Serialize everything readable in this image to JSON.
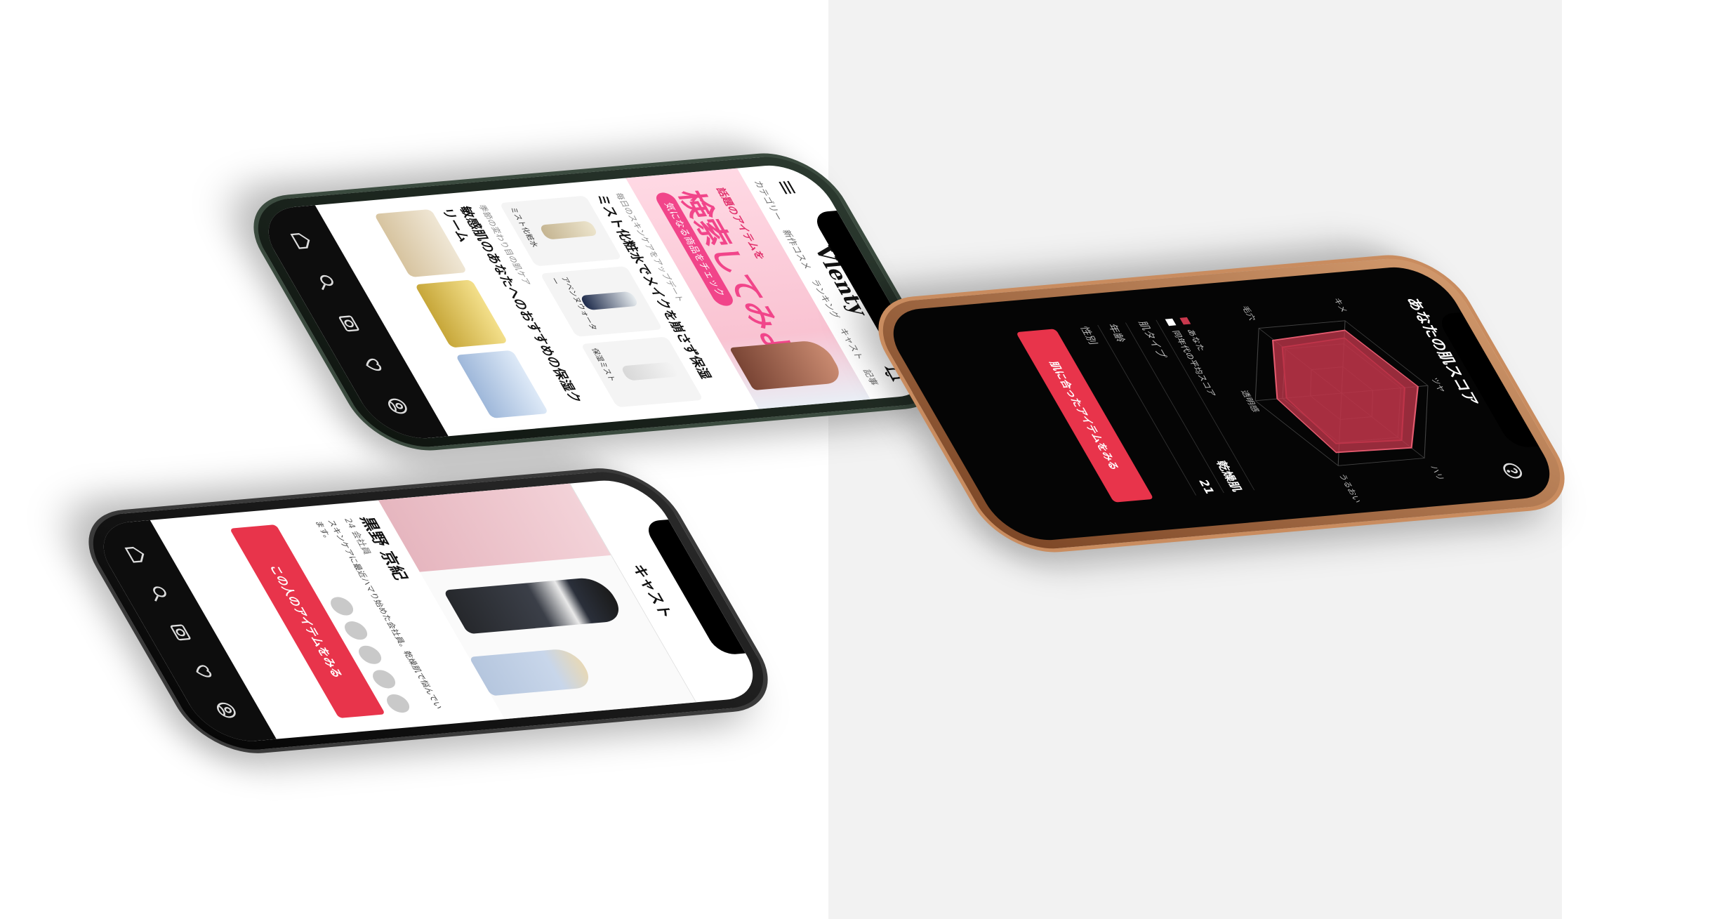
{
  "phones": {
    "home": {
      "logo": "Vlenty",
      "nav_tabs": [
        "カテゴリー",
        "新作コスメ",
        "ランキング",
        "キャスト",
        "記事"
      ],
      "banner": {
        "sub": "話題のアイテムを",
        "main": "検索してみよう",
        "pill": "気になる商品をチェック"
      },
      "article1": {
        "kicker": "毎日のスキンケアをアップデート",
        "title": "ミスト化粧水でメイクを崩さず保湿",
        "products": [
          "ミスト化粧水",
          "アベンヌウォーター",
          "保湿ミスト"
        ]
      },
      "article2": {
        "kicker": "季節の変わり目の肌ケア",
        "title": "敏感肌のあなたへのおすすめの保湿クリーム"
      }
    },
    "cast": {
      "title": "キャスト",
      "name": "黒野 京紀",
      "role": "24 会社員",
      "description": "スキンケアに最近ハマり始めた会社員。乾燥肌で悩んでいます。",
      "cta": "この人のアイテムをみる"
    },
    "score": {
      "title": "あなたの肌スコア",
      "axes": [
        "ツヤ",
        "ハリ",
        "うるおい",
        "透明感",
        "毛穴",
        "キメ"
      ],
      "legend": [
        "あなた",
        "同年代の平均スコア"
      ],
      "stats": [
        {
          "label": "肌タイプ",
          "value": "乾燥肌"
        },
        {
          "label": "年齢",
          "value": "21"
        },
        {
          "label": "性別",
          "value": ""
        }
      ],
      "cta": "肌に合ったアイテムをみる"
    }
  },
  "tab_icons": [
    "home-icon",
    "search-icon",
    "camera-icon",
    "favorite-icon",
    "mypage-icon"
  ],
  "colors": {
    "accent": "#e8344b",
    "radar_user": "#c8384d",
    "radar_avg": "#7a1f2e",
    "frame_dark_green": "#1f2a22",
    "frame_black": "#111111",
    "frame_gold": "#a7683e"
  }
}
